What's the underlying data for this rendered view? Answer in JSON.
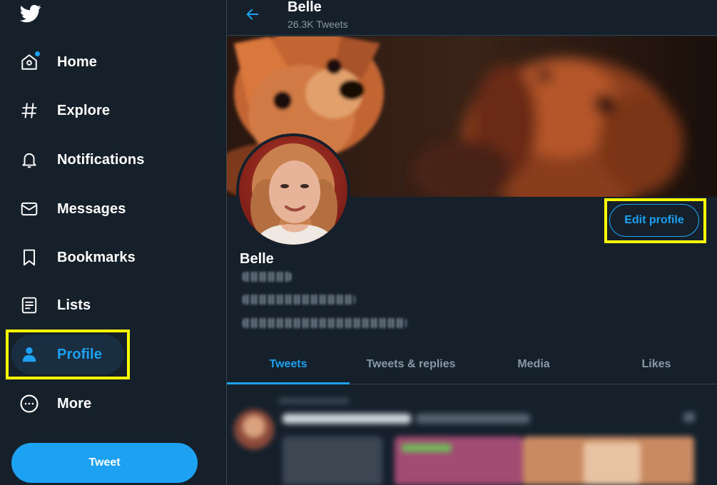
{
  "sidebar": {
    "items": [
      {
        "label": "Home",
        "icon": "home-icon"
      },
      {
        "label": "Explore",
        "icon": "hashtag-icon"
      },
      {
        "label": "Notifications",
        "icon": "bell-icon"
      },
      {
        "label": "Messages",
        "icon": "envelope-icon"
      },
      {
        "label": "Bookmarks",
        "icon": "bookmark-icon"
      },
      {
        "label": "Lists",
        "icon": "list-icon"
      },
      {
        "label": "Profile",
        "icon": "person-icon"
      },
      {
        "label": "More",
        "icon": "more-circle-icon"
      }
    ],
    "active": "Profile",
    "tweet_button": "Tweet"
  },
  "header": {
    "name": "Belle",
    "tweet_count": "26.3K Tweets"
  },
  "profile": {
    "name": "Belle",
    "edit_button": "Edit profile"
  },
  "tabs": [
    "Tweets",
    "Tweets & replies",
    "Media",
    "Likes"
  ],
  "active_tab": "Tweets",
  "colors": {
    "background": "#15202b",
    "accent": "#1da1f2",
    "secondary_text": "#8899a6",
    "highlight": "#ffff00"
  }
}
